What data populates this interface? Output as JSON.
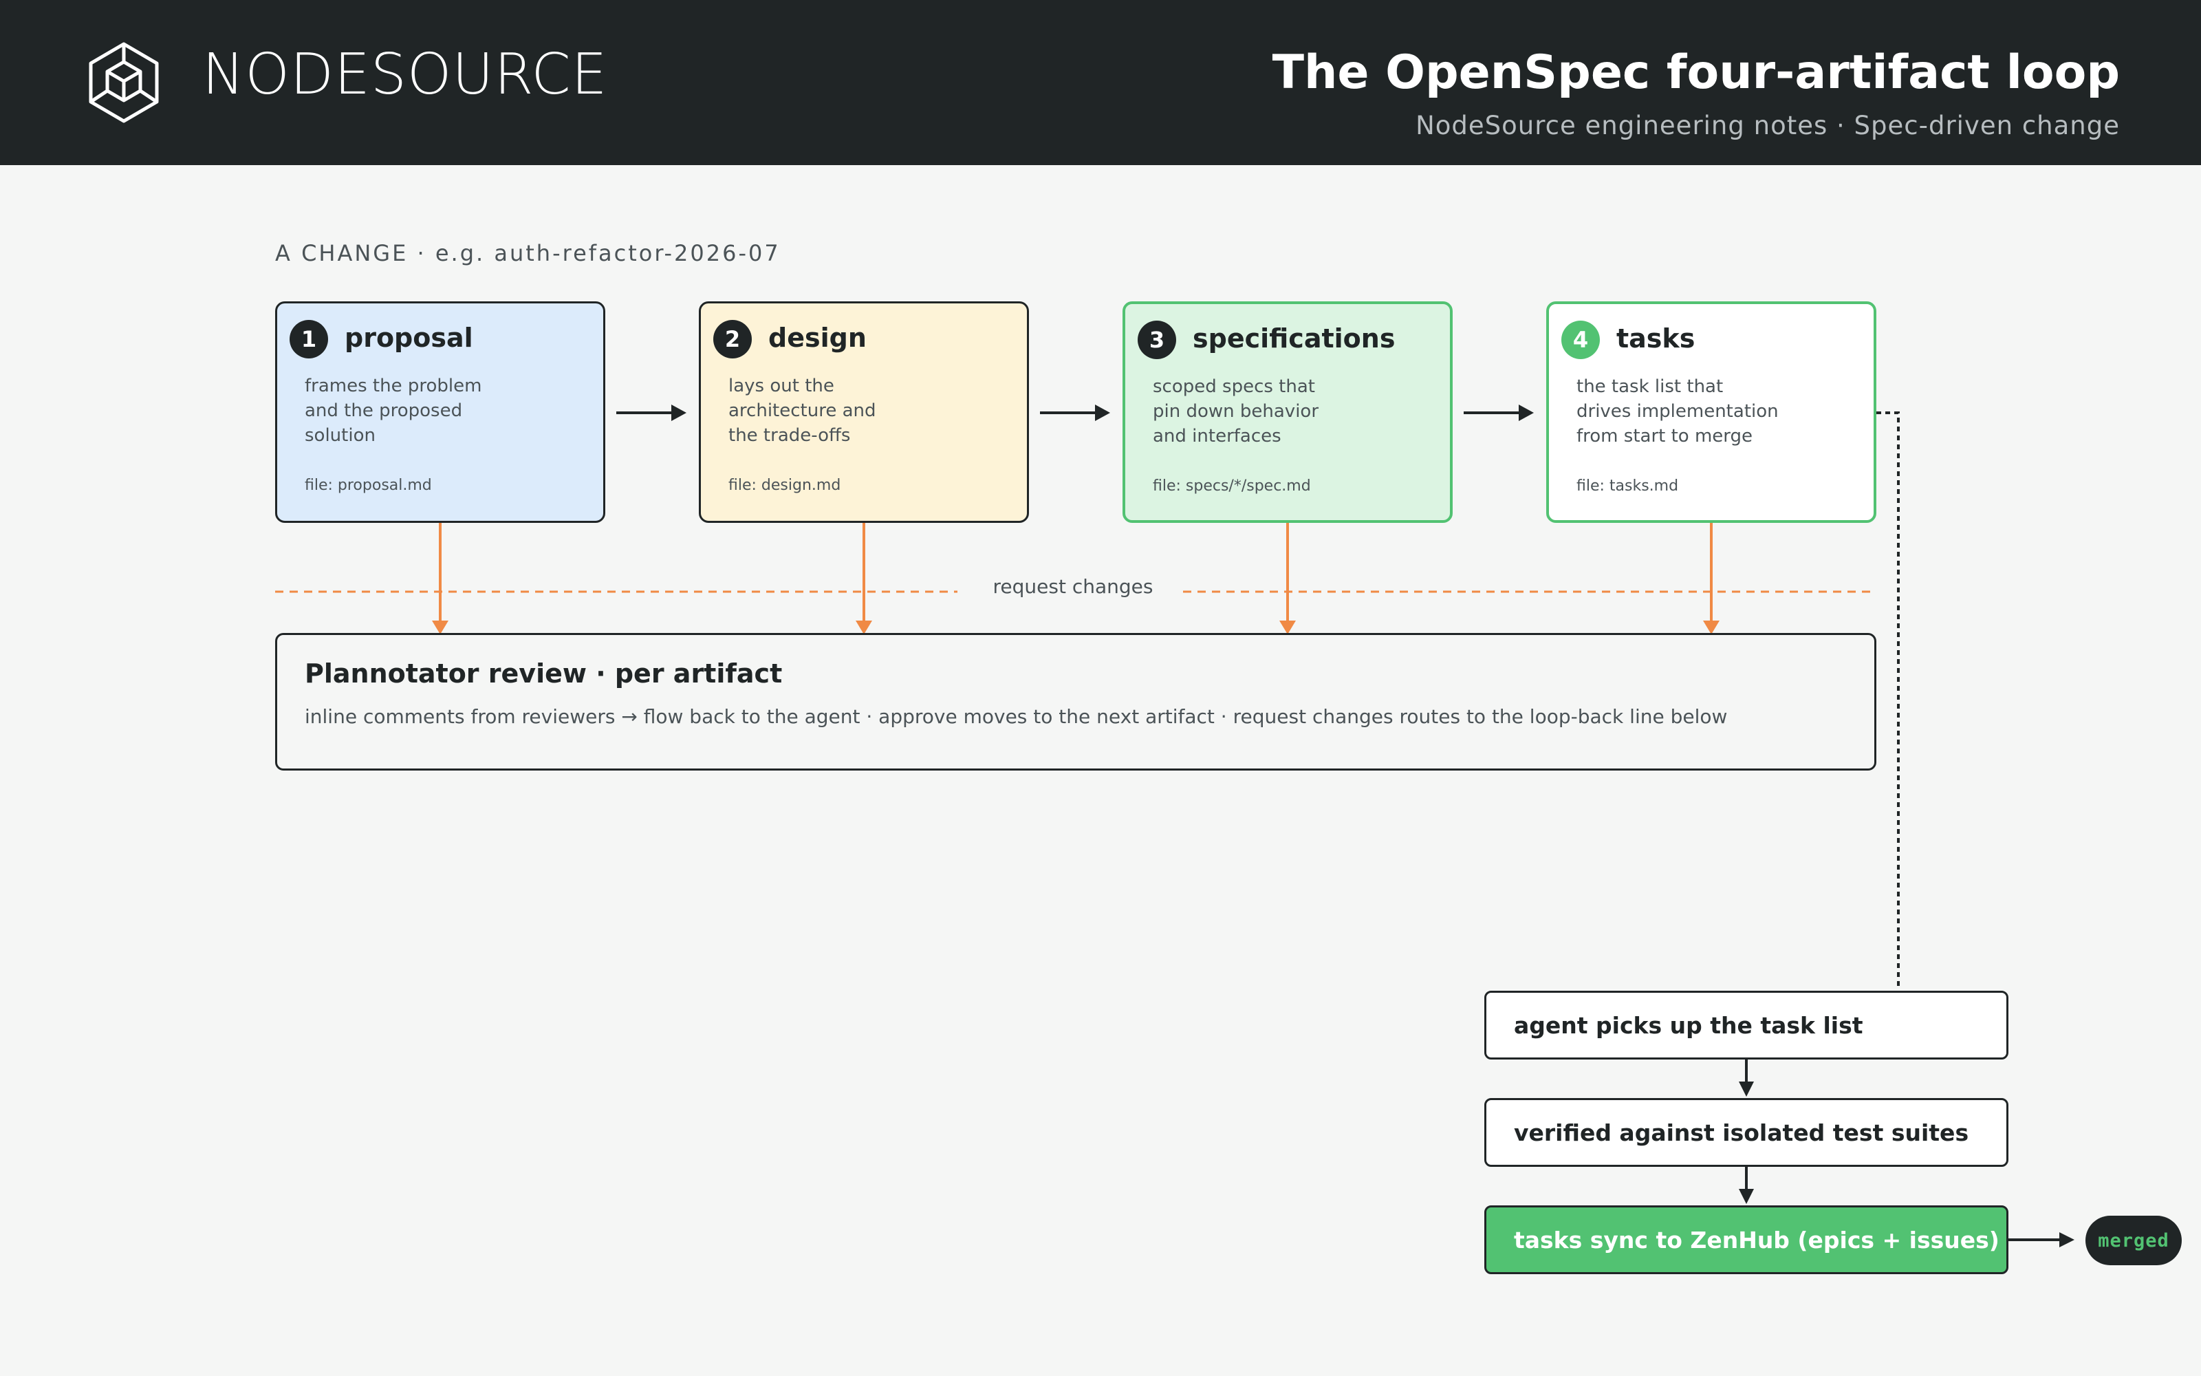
{
  "header": {
    "brand": "NODESOURCE",
    "title": "The OpenSpec four-artifact loop",
    "subtitle": "NodeSource engineering notes · Spec-driven change"
  },
  "change_label": "A CHANGE · e.g. auth-refactor-2026-07",
  "artifacts": [
    {
      "number": "1",
      "title": "proposal",
      "lines": [
        "frames the problem",
        "and the proposed",
        "solution"
      ],
      "file": "file: proposal.md",
      "fill": "#dcebfb",
      "border": "#202526"
    },
    {
      "number": "2",
      "title": "design",
      "lines": [
        "lays out the",
        "architecture and",
        "the trade-offs"
      ],
      "file": "file: design.md",
      "fill": "#fdf3d7",
      "border": "#202526"
    },
    {
      "number": "3",
      "title": "specifications",
      "lines": [
        "scoped specs that",
        "pin down behavior",
        "and interfaces"
      ],
      "file": "file: specs/*/spec.md",
      "fill": "#dcf4e2",
      "border": "#52c272"
    },
    {
      "number": "4",
      "title": "tasks",
      "lines": [
        "the task list that",
        "drives implementation",
        "from start to merge"
      ],
      "file": "file: tasks.md",
      "fill": "#ffffff",
      "border": "#52c272"
    }
  ],
  "request_changes_label": "request changes",
  "review": {
    "title": "Plannotator review · per artifact",
    "description": "inline comments from reviewers → flow back to the agent · approve moves to the next artifact · request changes routes to the loop-back line below"
  },
  "pipeline": [
    "agent picks up the task list",
    "verified against isolated test suites",
    "tasks sync to ZenHub (epics + issues)"
  ],
  "merged_label": "merged",
  "colors": {
    "dark": "#202526",
    "accent_green": "#52c272",
    "orange": "#f08a45",
    "background": "#f5f6f5"
  }
}
